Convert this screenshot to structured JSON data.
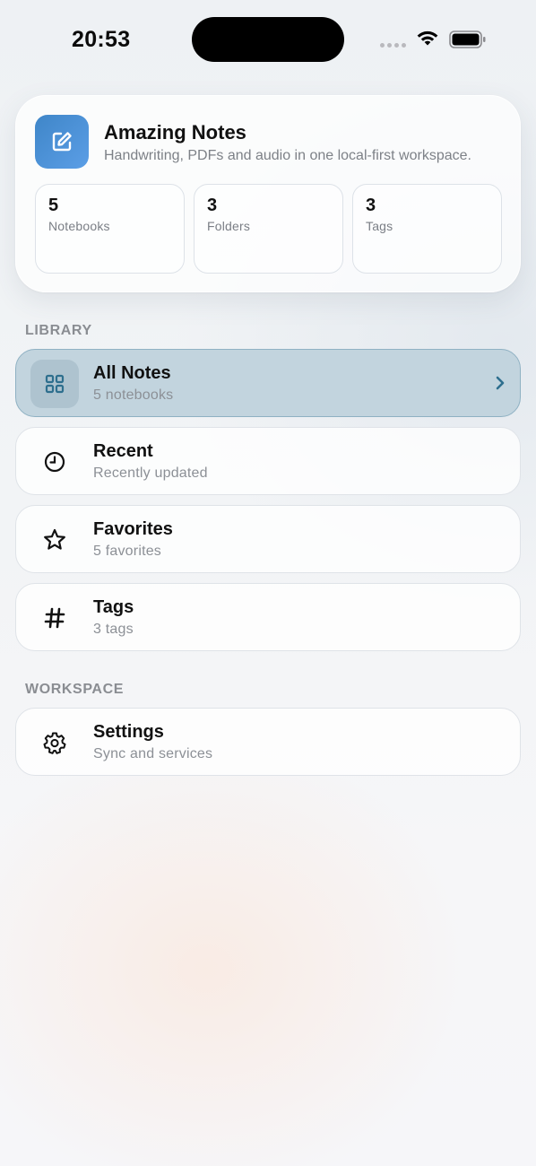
{
  "status": {
    "time": "20:53"
  },
  "header": {
    "title": "Amazing Notes",
    "subtitle": "Handwriting, PDFs and audio in one local-first workspace.",
    "stats": [
      {
        "value": "5",
        "label": "Notebooks"
      },
      {
        "value": "3",
        "label": "Folders"
      },
      {
        "value": "3",
        "label": "Tags"
      }
    ]
  },
  "library": {
    "label": "LIBRARY",
    "items": [
      {
        "title": "All Notes",
        "subtitle": "5 notebooks",
        "icon": "grid-icon",
        "active": true
      },
      {
        "title": "Recent",
        "subtitle": "Recently updated",
        "icon": "clock-icon"
      },
      {
        "title": "Favorites",
        "subtitle": "5 favorites",
        "icon": "star-icon"
      },
      {
        "title": "Tags",
        "subtitle": "3 tags",
        "icon": "hash-icon"
      }
    ]
  },
  "workspace": {
    "label": "WORKSPACE",
    "items": [
      {
        "title": "Settings",
        "subtitle": "Sync and services",
        "icon": "gear-icon"
      }
    ]
  },
  "colors": {
    "accent": "#4a90d9",
    "active_row": "#c2d4de",
    "active_icon": "#2e6f8e"
  }
}
